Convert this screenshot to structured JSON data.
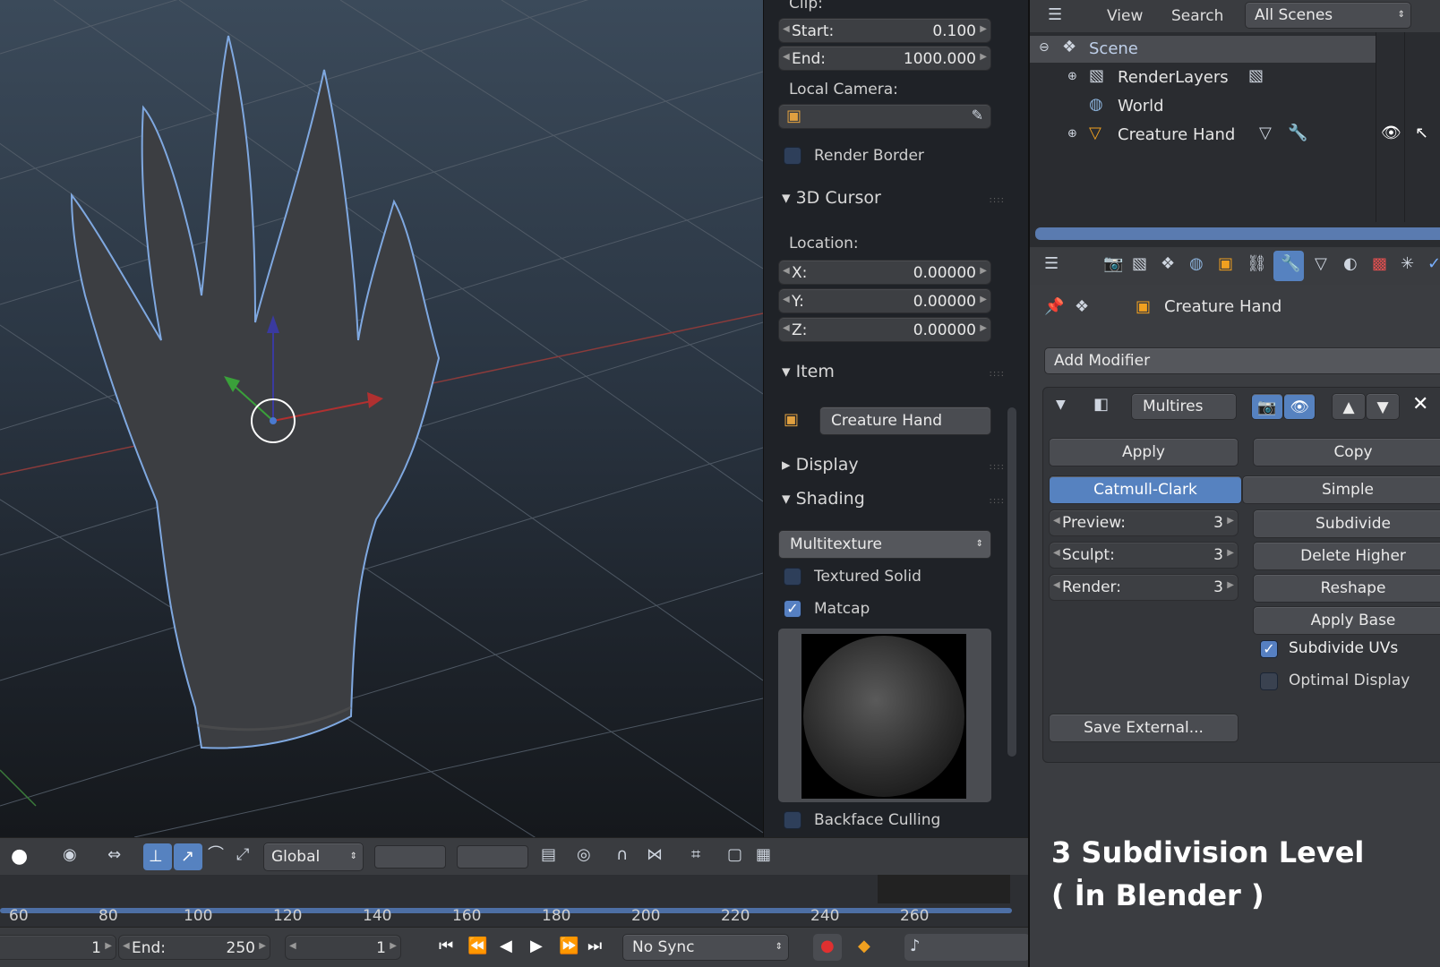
{
  "clip": {
    "header": "Clip:",
    "start_label": "Start:",
    "start_value": "0.100",
    "end_label": "End:",
    "end_value": "1000.000"
  },
  "local_camera": {
    "label": "Local Camera:"
  },
  "render_border": "Render Border",
  "cursor": {
    "header": "3D Cursor",
    "location_label": "Location:",
    "x_label": "X:",
    "x_value": "0.00000",
    "y_label": "Y:",
    "y_value": "0.00000",
    "z_label": "Z:",
    "z_value": "0.00000"
  },
  "item": {
    "header": "Item",
    "name": "Creature Hand"
  },
  "display": {
    "header": "Display"
  },
  "shading": {
    "header": "Shading",
    "mode": "Multitexture",
    "textured_solid": "Textured Solid",
    "matcap": "Matcap",
    "backface_culling": "Backface Culling"
  },
  "toolbar": {
    "orientation": "Global"
  },
  "timeline": {
    "ticks": [
      "60",
      "80",
      "100",
      "120",
      "140",
      "160",
      "180",
      "200",
      "220",
      "240",
      "260"
    ],
    "start_value": "1",
    "end_label": "End:",
    "end_value": "250",
    "current_frame": "1",
    "sync": "No Sync"
  },
  "outliner": {
    "view": "View",
    "search": "Search",
    "scenes": "All Scenes",
    "items": [
      "Scene",
      "RenderLayers",
      "World",
      "Creature Hand"
    ]
  },
  "properties": {
    "object_name": "Creature Hand",
    "add_modifier": "Add Modifier",
    "modifier_name": "Multires",
    "apply": "Apply",
    "copy": "Copy",
    "catmull": "Catmull-Clark",
    "simple": "Simple",
    "preview_label": "Preview:",
    "preview_value": "3",
    "sculpt_label": "Sculpt:",
    "sculpt_value": "3",
    "render_label": "Render:",
    "render_value": "3",
    "subdivide": "Subdivide",
    "delete_higher": "Delete Higher",
    "reshape": "Reshape",
    "apply_base": "Apply Base",
    "subdivide_uvs": "Subdivide UVs",
    "optimal_display": "Optimal Display",
    "save_external": "Save External..."
  },
  "caption": {
    "line1": "3 Subdivision Level",
    "line2": "( İn Blender )"
  }
}
